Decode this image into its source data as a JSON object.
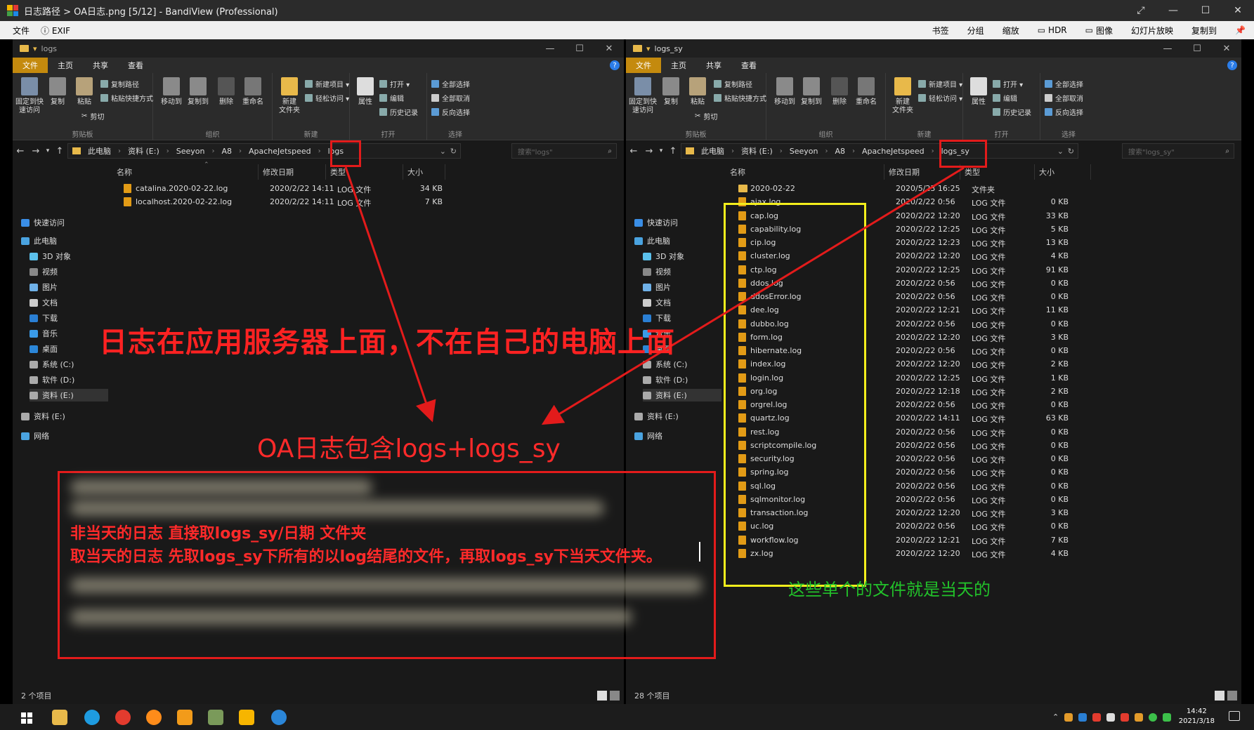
{
  "window": {
    "title": "日志路径 > OA日志.png [5/12] - BandiView (Professional)",
    "menu_left": [
      "文件",
      "EXIF"
    ],
    "menu_right": [
      "书签",
      "分组",
      "缩放",
      "HDR",
      "图像",
      "幻灯片放映",
      "复制到"
    ]
  },
  "left_explorer": {
    "title": "logs",
    "tabs": [
      "文件",
      "主页",
      "共享",
      "查看"
    ],
    "ribbon": {
      "clipboard": {
        "name": "剪贴板",
        "pin": "固定到快\n速访问",
        "copy": "复制",
        "paste": "粘贴",
        "copy_path": "复制路径",
        "paste_shortcut": "粘贴快捷方式",
        "cut": "剪切"
      },
      "organize": {
        "name": "组织",
        "move_to": "移动到",
        "copy_to": "复制到",
        "delete": "删除",
        "rename": "重命名"
      },
      "new": {
        "name": "新建",
        "new_folder": "新建\n文件夹",
        "new_item": "新建项目 ▾",
        "easy_access": "轻松访问 ▾"
      },
      "open": {
        "name": "打开",
        "properties": "属性",
        "open": "打开 ▾",
        "edit": "编辑",
        "history": "历史记录"
      },
      "select": {
        "name": "选择",
        "select_all": "全部选择",
        "select_none": "全部取消",
        "invert": "反向选择"
      }
    },
    "breadcrumb": [
      "此电脑",
      "资料 (E:)",
      "Seeyon",
      "A8",
      "ApacheJetspeed",
      "logs"
    ],
    "search_placeholder": "搜索\"logs\"",
    "columns": [
      "名称",
      "修改日期",
      "类型",
      "大小"
    ],
    "files": [
      {
        "name": "catalina.2020-02-22.log",
        "date": "2020/2/22 14:11",
        "type": "LOG 文件",
        "size": "34 KB"
      },
      {
        "name": "localhost.2020-02-22.log",
        "date": "2020/2/22 14:11",
        "type": "LOG 文件",
        "size": "7 KB"
      }
    ],
    "status": "2 个项目"
  },
  "right_explorer": {
    "title": "logs_sy",
    "tabs": [
      "文件",
      "主页",
      "共享",
      "查看"
    ],
    "breadcrumb": [
      "此电脑",
      "资料 (E:)",
      "Seeyon",
      "A8",
      "ApacheJetspeed",
      "logs_sy"
    ],
    "search_placeholder": "搜索\"logs_sy\"",
    "columns": [
      "名称",
      "修改日期",
      "类型",
      "大小"
    ],
    "files": [
      {
        "name": "2020-02-22",
        "date": "2020/5/23 16:25",
        "type": "文件夹",
        "size": "",
        "folder": true
      },
      {
        "name": "ajax.log",
        "date": "2020/2/22 0:56",
        "type": "LOG 文件",
        "size": "0 KB"
      },
      {
        "name": "cap.log",
        "date": "2020/2/22 12:20",
        "type": "LOG 文件",
        "size": "33 KB"
      },
      {
        "name": "capability.log",
        "date": "2020/2/22 12:25",
        "type": "LOG 文件",
        "size": "5 KB"
      },
      {
        "name": "cip.log",
        "date": "2020/2/22 12:23",
        "type": "LOG 文件",
        "size": "13 KB"
      },
      {
        "name": "cluster.log",
        "date": "2020/2/22 12:20",
        "type": "LOG 文件",
        "size": "4 KB"
      },
      {
        "name": "ctp.log",
        "date": "2020/2/22 12:25",
        "type": "LOG 文件",
        "size": "91 KB"
      },
      {
        "name": "ddos.log",
        "date": "2020/2/22 0:56",
        "type": "LOG 文件",
        "size": "0 KB"
      },
      {
        "name": "ddosError.log",
        "date": "2020/2/22 0:56",
        "type": "LOG 文件",
        "size": "0 KB"
      },
      {
        "name": "dee.log",
        "date": "2020/2/22 12:21",
        "type": "LOG 文件",
        "size": "11 KB"
      },
      {
        "name": "dubbo.log",
        "date": "2020/2/22 0:56",
        "type": "LOG 文件",
        "size": "0 KB"
      },
      {
        "name": "form.log",
        "date": "2020/2/22 12:20",
        "type": "LOG 文件",
        "size": "3 KB"
      },
      {
        "name": "hibernate.log",
        "date": "2020/2/22 0:56",
        "type": "LOG 文件",
        "size": "0 KB"
      },
      {
        "name": "index.log",
        "date": "2020/2/22 12:20",
        "type": "LOG 文件",
        "size": "2 KB"
      },
      {
        "name": "login.log",
        "date": "2020/2/22 12:25",
        "type": "LOG 文件",
        "size": "1 KB"
      },
      {
        "name": "org.log",
        "date": "2020/2/22 12:18",
        "type": "LOG 文件",
        "size": "2 KB"
      },
      {
        "name": "orgrel.log",
        "date": "2020/2/22 0:56",
        "type": "LOG 文件",
        "size": "0 KB"
      },
      {
        "name": "quartz.log",
        "date": "2020/2/22 14:11",
        "type": "LOG 文件",
        "size": "63 KB"
      },
      {
        "name": "rest.log",
        "date": "2020/2/22 0:56",
        "type": "LOG 文件",
        "size": "0 KB"
      },
      {
        "name": "scriptcompile.log",
        "date": "2020/2/22 0:56",
        "type": "LOG 文件",
        "size": "0 KB"
      },
      {
        "name": "security.log",
        "date": "2020/2/22 0:56",
        "type": "LOG 文件",
        "size": "0 KB"
      },
      {
        "name": "spring.log",
        "date": "2020/2/22 0:56",
        "type": "LOG 文件",
        "size": "0 KB"
      },
      {
        "name": "sql.log",
        "date": "2020/2/22 0:56",
        "type": "LOG 文件",
        "size": "0 KB"
      },
      {
        "name": "sqlmonitor.log",
        "date": "2020/2/22 0:56",
        "type": "LOG 文件",
        "size": "0 KB"
      },
      {
        "name": "transaction.log",
        "date": "2020/2/22 12:20",
        "type": "LOG 文件",
        "size": "3 KB"
      },
      {
        "name": "uc.log",
        "date": "2020/2/22 0:56",
        "type": "LOG 文件",
        "size": "0 KB"
      },
      {
        "name": "workflow.log",
        "date": "2020/2/22 12:21",
        "type": "LOG 文件",
        "size": "7 KB"
      },
      {
        "name": "zx.log",
        "date": "2020/2/22 12:20",
        "type": "LOG 文件",
        "size": "4 KB"
      }
    ],
    "status": "28 个项目"
  },
  "nav_pane": [
    "快速访问",
    "此电脑",
    "3D 对象",
    "视频",
    "图片",
    "文档",
    "下载",
    "音乐",
    "桌面",
    "系统 (C:)",
    "软件 (D:)",
    "资料 (E:)",
    "资料 (E:)",
    "网络"
  ],
  "annotations": {
    "main": "日志在应用服务器上面，不在自己的电脑上面",
    "oa": "OA日志包含logs+logs_sy",
    "note_line1": "非当天的日志  直接取logs_sy/日期 文件夹",
    "note_line2": "取当天的日志  先取logs_sy下所有的以log结尾的文件，再取logs_sy下当天文件夹。",
    "today": "这些单个的文件就是当天的"
  },
  "colors": {
    "red": "#e31b1b",
    "yellow": "#f3ee1c",
    "green": "#22c12a",
    "ribbon_active": "#c48a0e"
  },
  "taskbar": {
    "time": "14:42",
    "date": "2021/3/18"
  }
}
